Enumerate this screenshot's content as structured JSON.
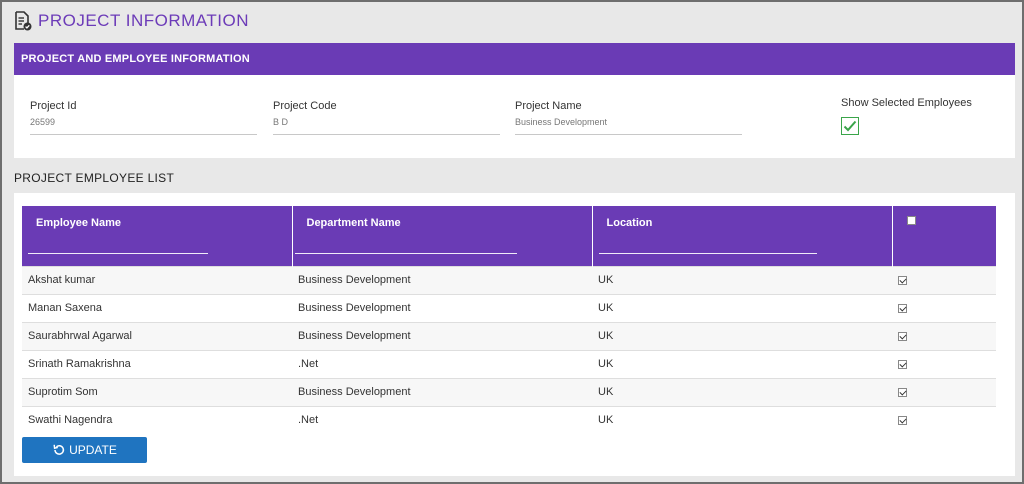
{
  "page": {
    "title": "PROJECT INFORMATION",
    "title_icon": "document-check-icon"
  },
  "info_panel": {
    "header": "PROJECT AND EMPLOYEE INFORMATION",
    "fields": [
      {
        "label": "Project Id",
        "value": "26599"
      },
      {
        "label": "Project Code",
        "value": "B D"
      },
      {
        "label": "Project Name",
        "value": "Business Development"
      }
    ],
    "show_selected": {
      "label": "Show Selected Employees",
      "checked": true
    }
  },
  "employee_list": {
    "title": "PROJECT EMPLOYEE LIST",
    "columns": [
      "Employee Name",
      "Department Name",
      "Location"
    ],
    "rows": [
      {
        "name": "Akshat kumar",
        "department": "Business Development",
        "location": "UK",
        "selected": true
      },
      {
        "name": "Manan Saxena",
        "department": "Business Development",
        "location": "UK",
        "selected": true
      },
      {
        "name": "Saurabhrwal Agarwal",
        "department": "Business Development",
        "location": "UK",
        "selected": true
      },
      {
        "name": "Srinath Ramakrishna",
        "department": ".Net",
        "location": "UK",
        "selected": true
      },
      {
        "name": "Suprotim Som",
        "department": "Business Development",
        "location": "UK",
        "selected": true
      },
      {
        "name": "Swathi Nagendra",
        "department": ".Net",
        "location": "UK",
        "selected": true
      }
    ],
    "update_button": {
      "label": "UPDATE",
      "icon": "refresh-icon"
    }
  },
  "colors": {
    "accent_purple": "#6a3bb5",
    "button_blue": "#1f74c0",
    "check_green": "#3aa54a"
  }
}
